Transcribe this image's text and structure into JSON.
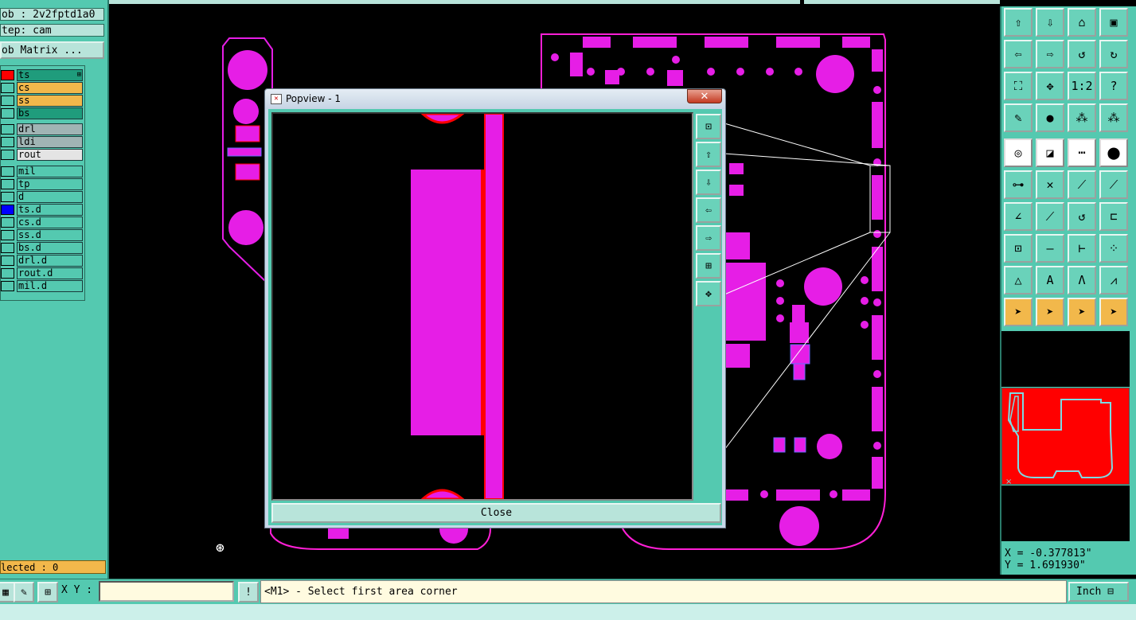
{
  "job_info": {
    "job": "ob : 2v2fptd1a0",
    "step": "tep: cam",
    "matrix_button": "ob Matrix ..."
  },
  "layers": {
    "board_layers": [
      {
        "name": "ts",
        "color": "#1f9c7c",
        "indicator": "#ff0000",
        "marker": "⊞"
      },
      {
        "name": "cs",
        "color": "#f2b84b",
        "indicator": "",
        "marker": ""
      },
      {
        "name": "ss",
        "color": "#f2b84b",
        "indicator": "",
        "marker": ""
      },
      {
        "name": "bs",
        "color": "#1f9c7c",
        "indicator": "",
        "marker": ""
      }
    ],
    "drill_layers": [
      {
        "name": "drl",
        "color": "#a0b4b4"
      },
      {
        "name": "ldi",
        "color": "#a0b4b4"
      },
      {
        "name": "rout",
        "color": "#e4e4e4"
      }
    ],
    "misc_layers": [
      {
        "name": "mil",
        "indicator": ""
      },
      {
        "name": "tp",
        "indicator": ""
      },
      {
        "name": "d",
        "indicator": ""
      },
      {
        "name": "ts.d",
        "indicator": "#0000ff"
      },
      {
        "name": "cs.d",
        "indicator": ""
      },
      {
        "name": "ss.d",
        "indicator": ""
      },
      {
        "name": "bs.d",
        "indicator": ""
      },
      {
        "name": "drl.d",
        "indicator": ""
      },
      {
        "name": "rout.d",
        "indicator": ""
      },
      {
        "name": "mil.d",
        "indicator": ""
      }
    ]
  },
  "status": {
    "selected": "lected : 0"
  },
  "popview": {
    "title": "Popview - 1",
    "close_x": "✕",
    "close_button": "Close",
    "side_buttons": [
      "zoom-fit-icon",
      "pan-up-icon",
      "pan-down-icon",
      "pan-left-icon",
      "pan-right-icon",
      "zoom-in-icon",
      "zoom-out-icon"
    ]
  },
  "toolbar": {
    "buttons": [
      {
        "name": "pan-up-icon",
        "glyph": "⇧",
        "style": ""
      },
      {
        "name": "pan-down-icon",
        "glyph": "⇩",
        "style": ""
      },
      {
        "name": "home-icon",
        "glyph": "⌂",
        "style": ""
      },
      {
        "name": "window-icon",
        "glyph": "▣",
        "style": ""
      },
      {
        "name": "pan-left-icon",
        "glyph": "⇦",
        "style": ""
      },
      {
        "name": "pan-right-icon",
        "glyph": "⇨",
        "style": ""
      },
      {
        "name": "undo-zoom-icon",
        "glyph": "↺",
        "style": ""
      },
      {
        "name": "redraw-icon",
        "glyph": "↻",
        "style": ""
      },
      {
        "name": "zoom-fit-icon",
        "glyph": "⛶",
        "style": ""
      },
      {
        "name": "zoom-center-icon",
        "glyph": "✥",
        "style": ""
      },
      {
        "name": "scale-icon",
        "glyph": "1:2",
        "style": ""
      },
      {
        "name": "help-icon",
        "glyph": "?",
        "style": ""
      },
      {
        "name": "measure-probe-icon",
        "glyph": "✎",
        "style": ""
      },
      {
        "name": "snap-icon",
        "glyph": "●",
        "style": ""
      },
      {
        "name": "layer-grid-icon",
        "glyph": "⁂",
        "style": ""
      },
      {
        "name": "layer-grid-red-icon",
        "glyph": "⁂",
        "style": ""
      },
      {
        "name": "pad-icon",
        "glyph": "◎",
        "style": "white"
      },
      {
        "name": "cross-select-icon",
        "glyph": "◪",
        "style": "white"
      },
      {
        "name": "ruler-icon",
        "glyph": "┅",
        "style": "white"
      },
      {
        "name": "dot-icon",
        "glyph": "⬤",
        "style": "white"
      },
      {
        "name": "connect-icon",
        "glyph": "⊶",
        "style": ""
      },
      {
        "name": "cross-icon",
        "glyph": "✕",
        "style": ""
      },
      {
        "name": "line-dist-icon",
        "glyph": "⟋",
        "style": ""
      },
      {
        "name": "point-dist-icon",
        "glyph": "⟋",
        "style": ""
      },
      {
        "name": "angle-icon",
        "glyph": "∠",
        "style": ""
      },
      {
        "name": "diag-icon",
        "glyph": "⟋",
        "style": ""
      },
      {
        "name": "arc-icon",
        "glyph": "↺",
        "style": ""
      },
      {
        "name": "flip-icon",
        "glyph": "⊏",
        "style": ""
      },
      {
        "name": "pad-dist-icon",
        "glyph": "⊡",
        "style": ""
      },
      {
        "name": "line-icon",
        "glyph": "—",
        "style": ""
      },
      {
        "name": "width-icon",
        "glyph": "⊢",
        "style": ""
      },
      {
        "name": "multi-pad-icon",
        "glyph": "⁘",
        "style": ""
      },
      {
        "name": "triangle-small-icon",
        "glyph": "△",
        "style": ""
      },
      {
        "name": "triangle-a-icon",
        "glyph": "A",
        "style": ""
      },
      {
        "name": "triangle-mid-icon",
        "glyph": "Λ",
        "style": ""
      },
      {
        "name": "triangle-wide-icon",
        "glyph": "⩘",
        "style": ""
      },
      {
        "name": "select-arrow-icon",
        "glyph": "➤",
        "style": "orange"
      },
      {
        "name": "select-box-icon",
        "glyph": "➤",
        "style": "orange"
      },
      {
        "name": "select-circle-icon",
        "glyph": "➤",
        "style": "orange"
      },
      {
        "name": "select-net-icon",
        "glyph": "➤",
        "style": "orange"
      }
    ]
  },
  "coordinates": {
    "x": "X = -0.377813\"",
    "y": "Y = 1.691930\""
  },
  "bottom_bar": {
    "xy_label": "X Y :",
    "xy_value": "",
    "message": "<M1> - Select first area corner",
    "units": "Inch ⊟",
    "exclaim": "!"
  },
  "colors": {
    "panel": "#54c9b0",
    "pcb_pad": "#e61ee6",
    "pcb_outline": "#ff1fd6",
    "highlight_red": "#ff0000"
  }
}
